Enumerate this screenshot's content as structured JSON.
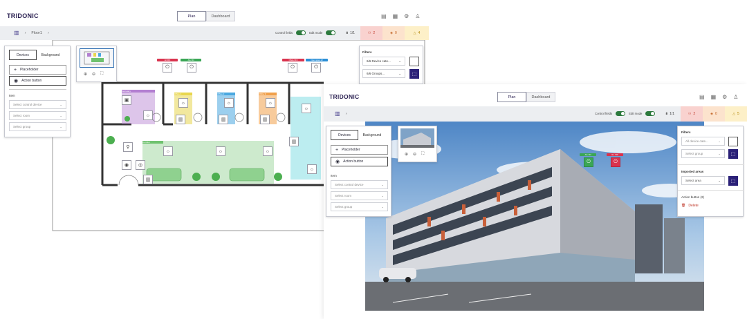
{
  "left_window": {
    "logo": "TRIDONIC",
    "tabs": [
      {
        "label": "Plan",
        "active": true
      },
      {
        "label": "Dashboard",
        "active": false
      }
    ],
    "breadcrumb": {
      "floor": "Floor1"
    },
    "toggles": [
      {
        "label": "Control fields",
        "on": true
      },
      {
        "label": "Edit mode",
        "on": true
      }
    ],
    "page_counter": "1/1",
    "alerts": [
      {
        "count": "2",
        "color": "#f9d2cf"
      },
      {
        "count": "0",
        "color": "#fce3cd"
      },
      {
        "count": "4",
        "color": "#fdf0c8"
      }
    ],
    "left_panel": {
      "tabs": [
        "Devices",
        "Background"
      ],
      "buttons": [
        "Placeholder",
        "Action button"
      ],
      "section_label": "Item",
      "selects": [
        "Select control device",
        "Select room",
        "Select group"
      ]
    },
    "filters": {
      "title": "Filters",
      "selects": [
        "6/6 Device cate...",
        "6/6 Groups..."
      ]
    },
    "plan_chips": [
      {
        "label": "All OFF",
        "color": "#d9334e"
      },
      {
        "label": "ALL ON",
        "color": "#3aa655"
      },
      {
        "label": "Offsite OFF",
        "color": "#d9334e"
      },
      {
        "label": "Open space off",
        "color": "#2b8fd6"
      }
    ],
    "rooms": [
      {
        "label": "Secretary",
        "color": "#b37fd1"
      },
      {
        "label": "Office 1",
        "color": "#e8d64e"
      },
      {
        "label": "Office 2",
        "color": "#4aa8e0"
      },
      {
        "label": "Office 3",
        "color": "#f0a04b"
      },
      {
        "label": "Corridor",
        "color": "#6fc26f"
      },
      {
        "label": "",
        "color": "#6ad6de"
      }
    ]
  },
  "right_window": {
    "logo": "TRIDONIC",
    "tabs": [
      {
        "label": "Plan",
        "active": true
      },
      {
        "label": "Dashboard",
        "active": false
      }
    ],
    "toggles": [
      {
        "label": "Control fields",
        "on": true
      },
      {
        "label": "Edit mode",
        "on": true
      }
    ],
    "page_counter": "1/1",
    "alerts": [
      {
        "count": "2",
        "color": "#f9d2cf"
      },
      {
        "count": "0",
        "color": "#fce3cd"
      },
      {
        "count": "5",
        "color": "#fdf0c8"
      }
    ],
    "left_panel": {
      "tabs": [
        "Devices",
        "Background"
      ],
      "buttons": [
        "Placeholder",
        "Action button"
      ],
      "section_label": "Item",
      "selects": [
        "Select control device",
        "Select room",
        "Select group"
      ]
    },
    "filters": {
      "title": "Filters",
      "selects": [
        "All device cate...",
        "Select group"
      ],
      "imported_title": "Imported areas",
      "imported_select": "Select area",
      "action_title": "Action button (2)",
      "delete_label": "Delete"
    },
    "building_chips": [
      {
        "label": "ALL ON",
        "color": "#3aa655"
      },
      {
        "label": "ALL OFF",
        "color": "#d9334e"
      }
    ]
  }
}
